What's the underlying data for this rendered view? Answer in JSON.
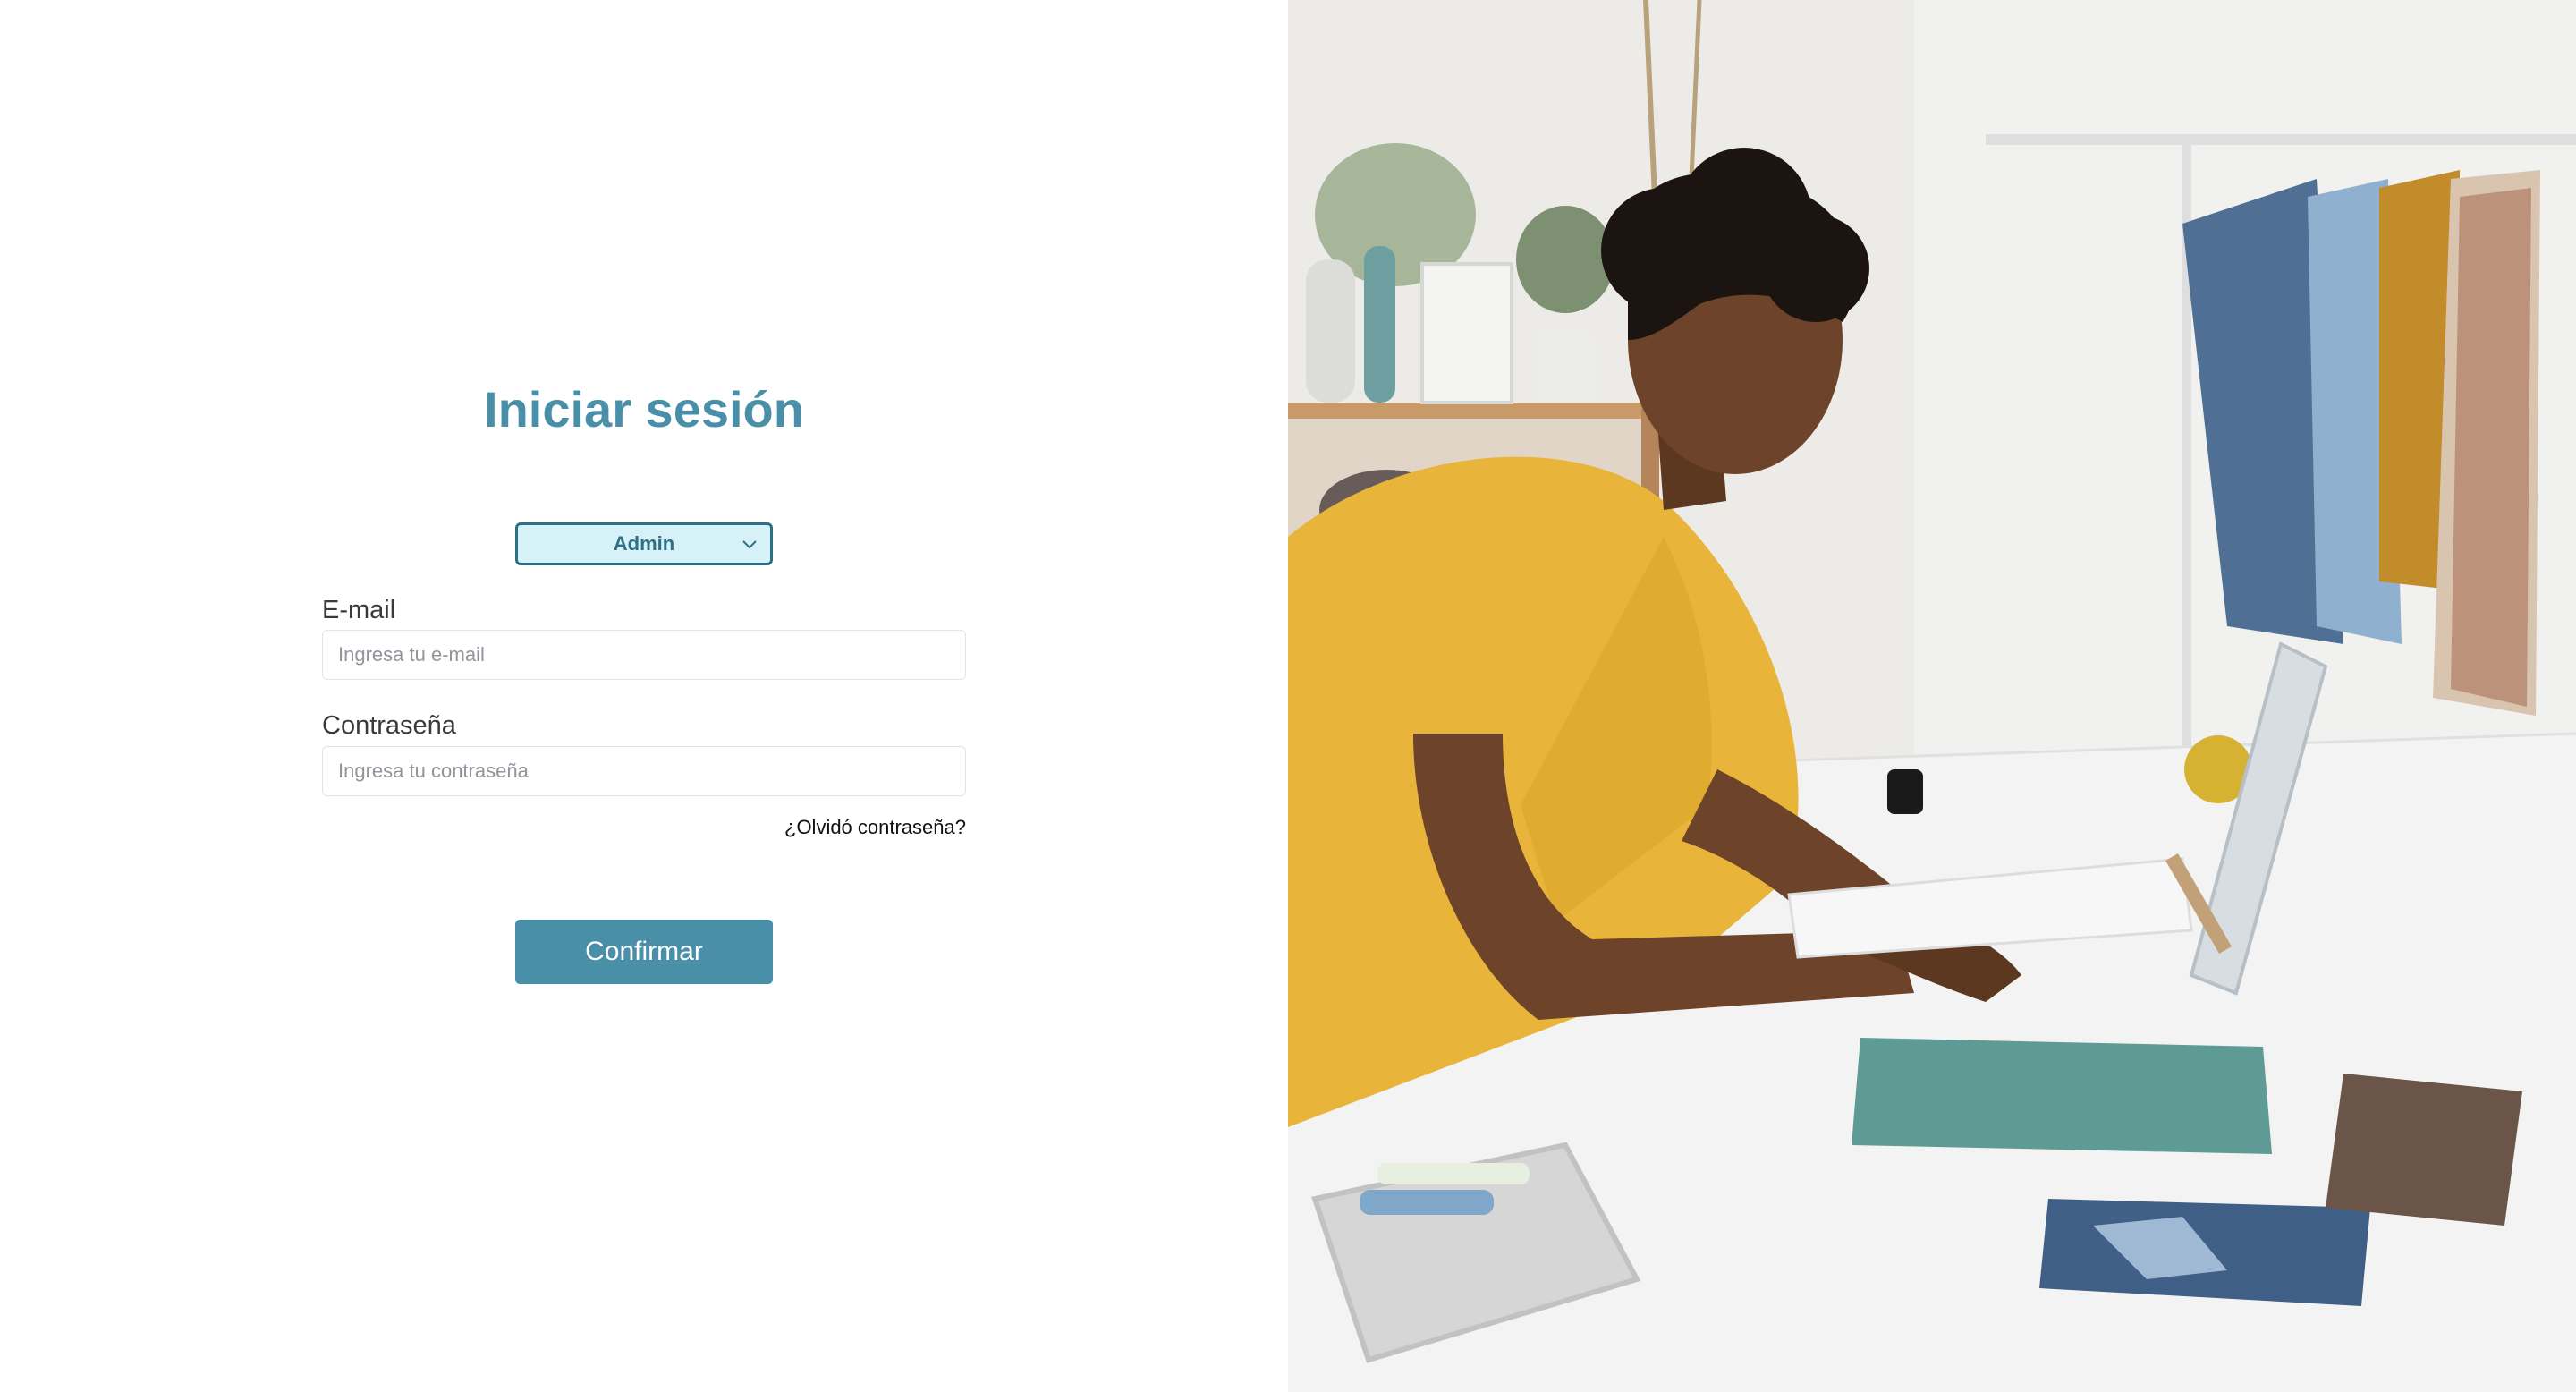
{
  "login": {
    "title": "Iniciar sesión",
    "role_select": {
      "selected": "Admin"
    },
    "email": {
      "label": "E-mail",
      "placeholder": "Ingresa tu e-mail"
    },
    "password": {
      "label": "Contraseña",
      "placeholder": "Ingresa tu contraseña"
    },
    "forgot_password": "¿Olvidó contraseña?",
    "confirm": "Confirmar"
  },
  "colors": {
    "accent": "#4a8fa8",
    "select_bg": "#d7f1f9",
    "select_border": "#2f6f84"
  },
  "icons": {
    "role_select": "chevron-down-icon"
  }
}
